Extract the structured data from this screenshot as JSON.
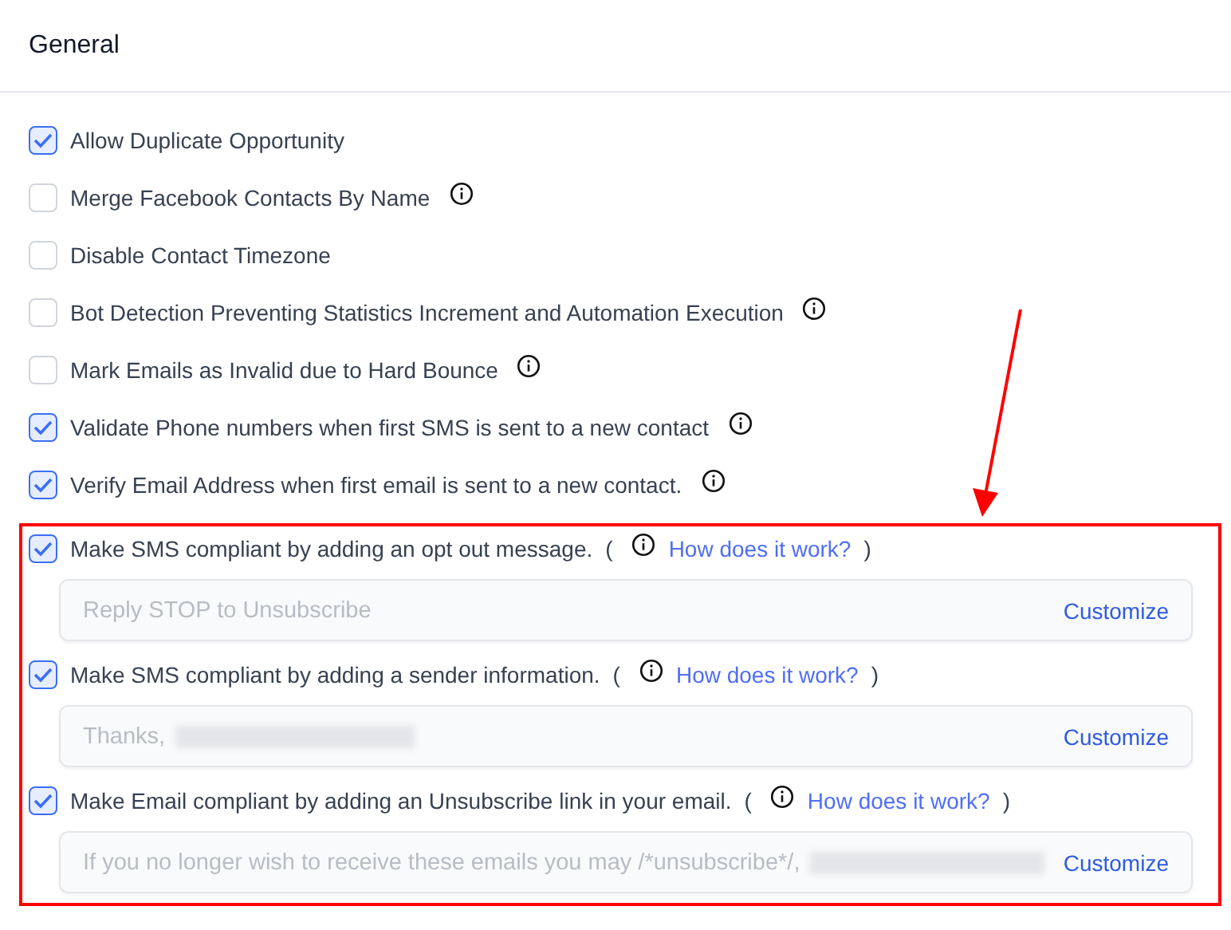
{
  "title": "General",
  "options": [
    {
      "label": "Allow Duplicate Opportunity",
      "checked": true,
      "info": false
    },
    {
      "label": "Merge Facebook Contacts By Name",
      "checked": false,
      "info": true
    },
    {
      "label": "Disable Contact Timezone",
      "checked": false,
      "info": false
    },
    {
      "label": "Bot Detection Preventing Statistics Increment and Automation Execution",
      "checked": false,
      "info": true
    },
    {
      "label": "Mark Emails as Invalid due to Hard Bounce",
      "checked": false,
      "info": true
    },
    {
      "label": "Validate Phone numbers when first SMS is sent to a new contact",
      "checked": true,
      "info": true
    },
    {
      "label": "Verify Email Address when first email is sent to a new contact.",
      "checked": true,
      "info": true
    }
  ],
  "compliance": [
    {
      "label": "Make SMS compliant by adding an opt out message.",
      "checked": true,
      "open_paren": "(",
      "link": "How does it work?",
      "close_paren": ")",
      "field_text": "Reply STOP to Unsubscribe",
      "redacted": false,
      "action": "Customize"
    },
    {
      "label": "Make SMS compliant by adding a sender information.",
      "checked": true,
      "open_paren": "(",
      "link": "How does it work?",
      "close_paren": ")",
      "field_text": "Thanks,",
      "redacted": true,
      "action": "Customize"
    },
    {
      "label": "Make Email compliant by adding an Unsubscribe link in your email.",
      "checked": true,
      "open_paren": "(",
      "link": "How does it work?",
      "close_paren": ")",
      "field_text": "If you no longer wish to receive these emails you may /*unsubscribe*/,",
      "redacted": true,
      "action": "Customize"
    }
  ]
}
